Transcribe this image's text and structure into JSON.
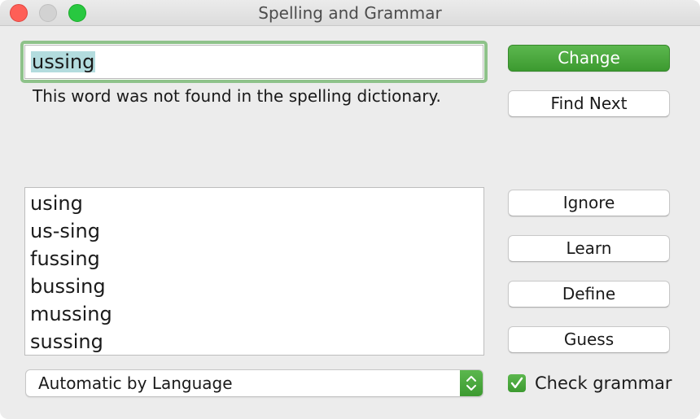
{
  "window": {
    "title": "Spelling and Grammar"
  },
  "misspelled": {
    "word": "ussing",
    "message": "This word was not found in the spelling dictionary."
  },
  "buttons": {
    "change": "Change",
    "find_next": "Find Next",
    "ignore": "Ignore",
    "learn": "Learn",
    "define": "Define",
    "guess": "Guess"
  },
  "suggestions": [
    "using",
    "us-sing",
    "fussing",
    "bussing",
    "mussing",
    "sussing"
  ],
  "language_select": {
    "selected": "Automatic by Language"
  },
  "check_grammar": {
    "label": "Check grammar",
    "checked": true
  },
  "colors": {
    "accent_green": "#4caf42",
    "focus_ring": "#8ec28a",
    "selection": "#b3dcde"
  }
}
